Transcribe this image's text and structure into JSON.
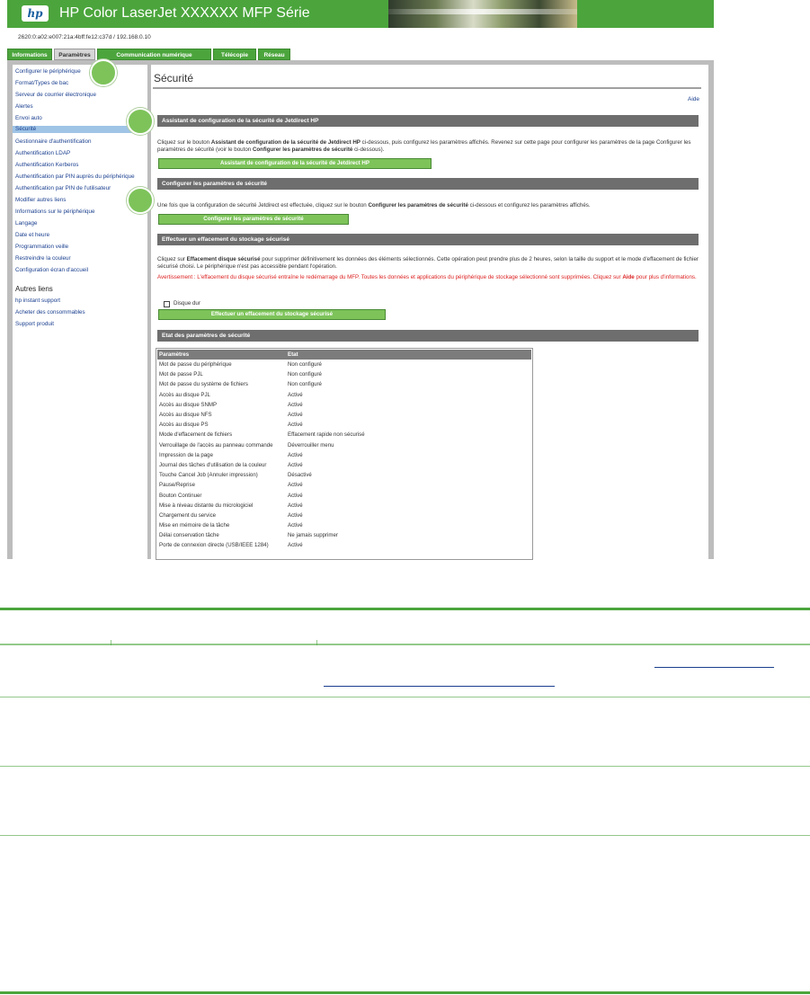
{
  "header": {
    "logo_text": "hp",
    "title": "HP Color LaserJet XXXXXX MFP Série"
  },
  "address": "2620:0:a02:e007:21a:4bff:fe12:c37d / 192.168.0.10",
  "tabs": [
    "Informations",
    "Paramètres",
    "Communication numérique",
    "Télécopie",
    "Réseau"
  ],
  "sidebar": {
    "items": [
      "Configurer le périphérique",
      "Format/Types de bac",
      "Serveur de courrier électronique",
      "Alertes",
      "Envoi auto",
      "Sécurité",
      "Gestionnaire d'authentification",
      "Authentification LDAP",
      "Authentification Kerberos",
      "Authentification par PIN auprès du périphérique",
      "Authentification par PIN de l'utilisateur",
      "Modifier autres liens",
      "Informations sur le périphérique",
      "Langage",
      "Date et heure",
      "Programmation veille",
      "Restreindre la couleur",
      "Configuration écran d'accueil"
    ],
    "other_heading": "Autres liens",
    "other_items": [
      "hp instant support",
      "Acheter des consommables",
      "Support produit"
    ]
  },
  "content": {
    "title": "Sécurité",
    "help": "Aide",
    "sec1": {
      "bar": "Assistant de configuration de la sécurité de Jetdirect HP",
      "text_a": "Cliquez sur le bouton ",
      "text_b": "Assistant de configuration de la sécurité de Jetdirect HP",
      "text_c": " ci-dessous, puis configurez les paramètres affichés. Revenez sur cette page pour configurer les paramètres de la page Configurer les paramètres de sécurité (voir le bouton ",
      "text_d": "Configurer les paramètres de sécurité",
      "text_e": " ci-dessous).",
      "button": "Assistant de configuration de la sécurité de Jetdirect HP"
    },
    "sec2": {
      "bar": "Configurer les paramètres de sécurité",
      "text_a": "Une fois que la configuration de sécurité Jetdirect est effectuée, cliquez sur le bouton ",
      "text_b": "Configurer les paramètres de sécurité",
      "text_c": " ci-dessous et configurez les paramètres affichés.",
      "button": "Configurer les paramètres de sécurité"
    },
    "sec3": {
      "bar": "Effectuer un effacement du stockage sécurisé",
      "text_a": "Cliquez sur ",
      "text_b": "Effacement disque sécurisé",
      "text_c": " pour supprimer définitivement les données des éléments sélectionnés. Cette opération peut prendre plus de 2 heures, selon la taille du support et le mode d'effacement de fichier sécurisé choisi. Le périphérique n'est pas accessible pendant l'opération.",
      "warning": "Avertissement : L'effacement du disque sécurisé entraîne le redémarrage du MFP. Toutes les données et applications du périphérique de stockage sélectionné sont supprimées. Cliquez sur ",
      "warning_link": "Aide",
      "warning_end": " pour plus d'informations.",
      "checkbox_label": "Disque dur",
      "button": "Effectuer un effacement du stockage sécurisé"
    },
    "sec4": {
      "bar": "Etat des paramètres de sécurité",
      "col1": "Paramètres",
      "col2": "Etat",
      "rows": [
        [
          "Mot de passe du périphérique",
          "Non configuré"
        ],
        [
          "Mot de passe PJL",
          "Non configuré"
        ],
        [
          "Mot de passe du système de fichiers",
          "Non configuré"
        ],
        [
          "Accès au disque PJL",
          "Activé"
        ],
        [
          "Accès au disque SNMP",
          "Activé"
        ],
        [
          "Accès au disque NFS",
          "Activé"
        ],
        [
          "Accès au disque PS",
          "Activé"
        ],
        [
          "Mode d'effacement de fichiers",
          "Effacement rapide non sécurisé"
        ],
        [
          "Verrouillage de l'accès au panneau commande",
          "Déverrouiller menu"
        ],
        [
          "Impression de la page",
          "Activé"
        ],
        [
          "Journal des tâches d'utilisation de la couleur",
          "Activé"
        ],
        [
          "Touche Cancel Job (Annuler impression)",
          "Désactivé"
        ],
        [
          "Pause/Reprise",
          "Activé"
        ],
        [
          "Bouton Continuer",
          "Activé"
        ],
        [
          "Mise à niveau distante du micrologiciel",
          "Activé"
        ],
        [
          "Chargement du service",
          "Activé"
        ],
        [
          "Mise en mémoire de la tâche",
          "Activé"
        ],
        [
          "Délai conservation tâche",
          "Ne jamais supprimer"
        ],
        [
          "Porte de connexion directe (USB/IEEE 1284)",
          "Activé"
        ]
      ]
    }
  },
  "colors": {
    "brand_green": "#4ba53c",
    "button_green": "#7dc35a",
    "bar_gray": "#6e6e6e",
    "link_blue": "#1a3f8f",
    "warning_red": "#dd2222"
  }
}
